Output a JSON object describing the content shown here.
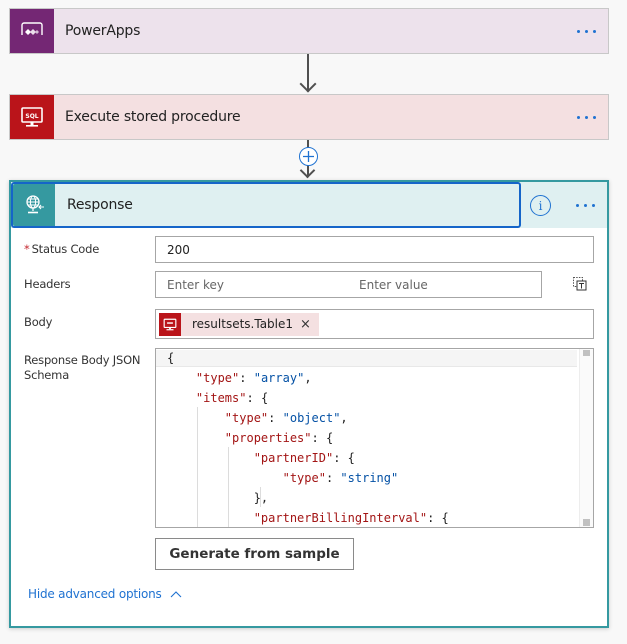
{
  "flow": {
    "steps": [
      {
        "title": "PowerApps",
        "icon": "powerapps-icon",
        "color": "#742774"
      },
      {
        "title": "Execute stored procedure",
        "icon": "sql-icon",
        "color": "#ba141a"
      }
    ],
    "response": {
      "title": "Response",
      "icon": "response-globe-icon",
      "color": "#3599a0",
      "fields": {
        "status_code": {
          "label": "Status Code",
          "required_mark": "*",
          "value": "200"
        },
        "headers": {
          "label": "Headers",
          "key_placeholder": "Enter key",
          "value_placeholder": "Enter value"
        },
        "body": {
          "label": "Body",
          "token": "resultsets.Table1",
          "token_remove": "×"
        },
        "schema": {
          "label": "Response Body JSON Schema",
          "lines": [
            "{",
            "    \"type\": \"array\",",
            "    \"items\": {",
            "        \"type\": \"object\",",
            "        \"properties\": {",
            "            \"partnerID\": {",
            "                \"type\": \"string\"",
            "            },",
            "            \"partnerBillingInterval\": {"
          ]
        }
      },
      "generate_button": "Generate from sample",
      "hide_advanced": "Hide advanced options"
    }
  }
}
